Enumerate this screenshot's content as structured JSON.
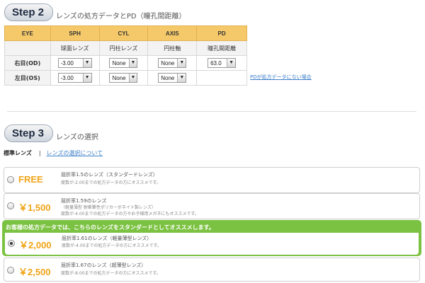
{
  "step2": {
    "label": "Step 2",
    "title": "レンズの処方データとPD（瞳孔間距離）"
  },
  "rx_table": {
    "headers": [
      "EYE",
      "SPH",
      "CYL",
      "AXIS",
      "PD"
    ],
    "subheaders": [
      "",
      "球面レンズ",
      "円柱レンズ",
      "円柱軸",
      "瞳孔間距離"
    ],
    "rows": [
      {
        "eye": "右目(OD)",
        "sph": "-3.00",
        "cyl": "None",
        "axis": "None",
        "pd": "63.0"
      },
      {
        "eye": "左目(OS)",
        "sph": "-3.00",
        "cyl": "None",
        "axis": "None",
        "pd": ""
      }
    ],
    "dropdown_arrow": "▼"
  },
  "pd_link": "PDが処方データにない場合",
  "step3": {
    "label": "Step 3",
    "title": "レンズの選択"
  },
  "lens_tabs": {
    "standard": "標準レンズ",
    "separator": "|",
    "about_link": "レンズの選択について"
  },
  "recommend_banner": "お客様の処方データでは、こちらのレンズをスタンダードとしてオススメします。",
  "lens_options": [
    {
      "price": "FREE",
      "line1": "屈折率1.5のレンズ（スタンダードレンズ）",
      "line2": "度数が-2.00までの処方データの方にオススメです。",
      "line3": "",
      "selected": false
    },
    {
      "price": "￥1,500",
      "line1": "屈折率1.59のレンズ",
      "line2": "（軽量薄型 耐衝撃性ポリカーボネイト製レンズ）",
      "line3": "度数が-4.00までの処方データの方やお子様用メガネにもオススメです。",
      "selected": false
    },
    {
      "price": "￥2,000",
      "line1": "屈折率1.61のレンズ（軽量薄型レンズ）",
      "line2": "度数が-4.00までの処方データの方にオススメです。",
      "line3": "",
      "selected": true
    },
    {
      "price": "￥2,500",
      "line1": "屈折率1.67のレンズ（超薄型レンズ）",
      "line2": "度数が-8.00までの処方データの方にオススメです。",
      "line3": "",
      "selected": false
    }
  ],
  "colors": {
    "header_orange": "#f5c96a",
    "price_orange": "#f0a418",
    "recommend_green": "#7cc242",
    "link_blue": "#3a7ec8"
  }
}
